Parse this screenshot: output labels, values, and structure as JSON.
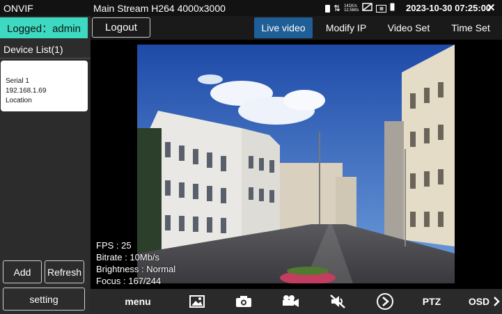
{
  "status_bar": {
    "app_name": "ONVIF",
    "stream_info": "Main Stream H264 4000x3000",
    "net_rate_up": "141K/s",
    "net_rate_down": "12.5M/s",
    "datetime": "2023-10-30 07:25:00",
    "icons": [
      "battery-icon",
      "network-arrows-icon",
      "no-signal-icon",
      "poe-icon",
      "phone-icon",
      "close-icon"
    ]
  },
  "sidebar": {
    "logged_text": "Logged：admin",
    "device_list_title": "Device List(1)",
    "device": {
      "serial": "Serial 1",
      "ip": "192.168.1.69",
      "location": "Location"
    },
    "add_label": "Add",
    "refresh_label": "Refresh",
    "setting_label": "setting"
  },
  "toolbar": {
    "logout_label": "Logout",
    "tabs": [
      {
        "label": "Live video",
        "active": true
      },
      {
        "label": "Modify IP",
        "active": false
      },
      {
        "label": "Video Set",
        "active": false
      },
      {
        "label": "Time Set",
        "active": false
      }
    ]
  },
  "video": {
    "fps": "FPS : 25",
    "bitrate": "Bitrate : 10Mb/s",
    "brightness": "Brightness : Normal",
    "focus": "Focus : 167/244"
  },
  "bottom_bar": {
    "menu_label": "menu",
    "ptz_label": "PTZ",
    "osd_label": "OSD",
    "icons": [
      "gallery-icon",
      "camera-icon",
      "record-icon",
      "audio-mute-icon",
      "play-icon",
      "chevron-right-icon"
    ]
  },
  "colors": {
    "accent_teal": "#3dd9c1",
    "active_tab": "#1f5e96"
  }
}
